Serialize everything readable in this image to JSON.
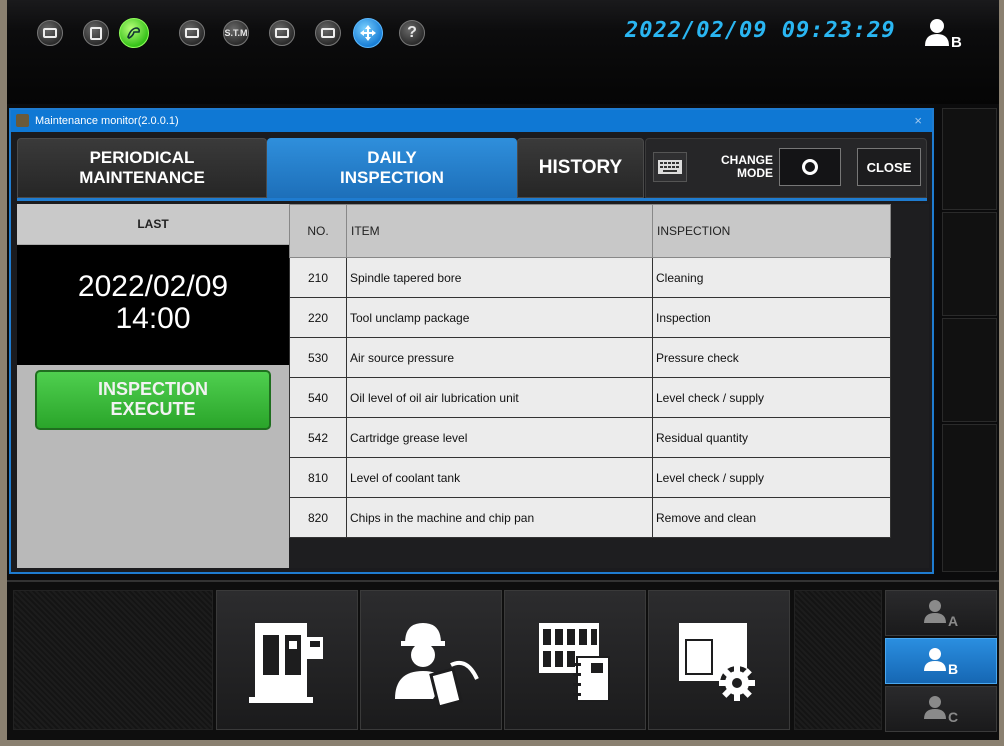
{
  "topbar": {
    "clock": "2022/02/09 09:23:29",
    "icons": [
      {
        "name": "exit-icon"
      },
      {
        "name": "document-icon"
      },
      {
        "name": "hand-icon"
      },
      {
        "name": "window-icon"
      },
      {
        "name": "stm-icon",
        "label": "S.T.M"
      },
      {
        "name": "monitor-icon"
      },
      {
        "name": "display-icon"
      },
      {
        "name": "move-icon"
      },
      {
        "name": "help-icon",
        "label": "?"
      }
    ],
    "user_label": "B"
  },
  "dialog": {
    "title": "Maintenance monitor(2.0.0.1)",
    "close_x": "×",
    "tabs": {
      "periodical_line1": "PERIODICAL",
      "periodical_line2": "MAINTENANCE",
      "daily_line1": "DAILY",
      "daily_line2": "INSPECTION",
      "history": "HISTORY"
    },
    "change_mode_line1": "CHANGE",
    "change_mode_line2": "MODE",
    "close_label": "CLOSE"
  },
  "left": {
    "last_label": "LAST",
    "last_date": "2022/02/09",
    "last_time": "14:00",
    "execute_line1": "INSPECTION",
    "execute_line2": "EXECUTE"
  },
  "table": {
    "headers": {
      "no": "NO.",
      "item": "ITEM",
      "inspection": "INSPECTION"
    },
    "rows": [
      {
        "no": "210",
        "item": "Spindle tapered bore",
        "inspection": "Cleaning"
      },
      {
        "no": "220",
        "item": "Tool unclamp package",
        "inspection": "Inspection"
      },
      {
        "no": "530",
        "item": "Air source pressure",
        "inspection": "Pressure check"
      },
      {
        "no": "540",
        "item": "Oil level of oil air lubrication unit",
        "inspection": "Level check / supply"
      },
      {
        "no": "542",
        "item": "Cartridge grease level",
        "inspection": "Residual quantity"
      },
      {
        "no": "810",
        "item": "Level of coolant tank",
        "inspection": "Level check / supply"
      },
      {
        "no": "820",
        "item": "Chips in the machine and chip pan",
        "inspection": "Remove and clean"
      }
    ]
  },
  "dock": {
    "users": [
      {
        "label": "A",
        "active": false
      },
      {
        "label": "B",
        "active": true
      },
      {
        "label": "C",
        "active": false
      }
    ]
  }
}
